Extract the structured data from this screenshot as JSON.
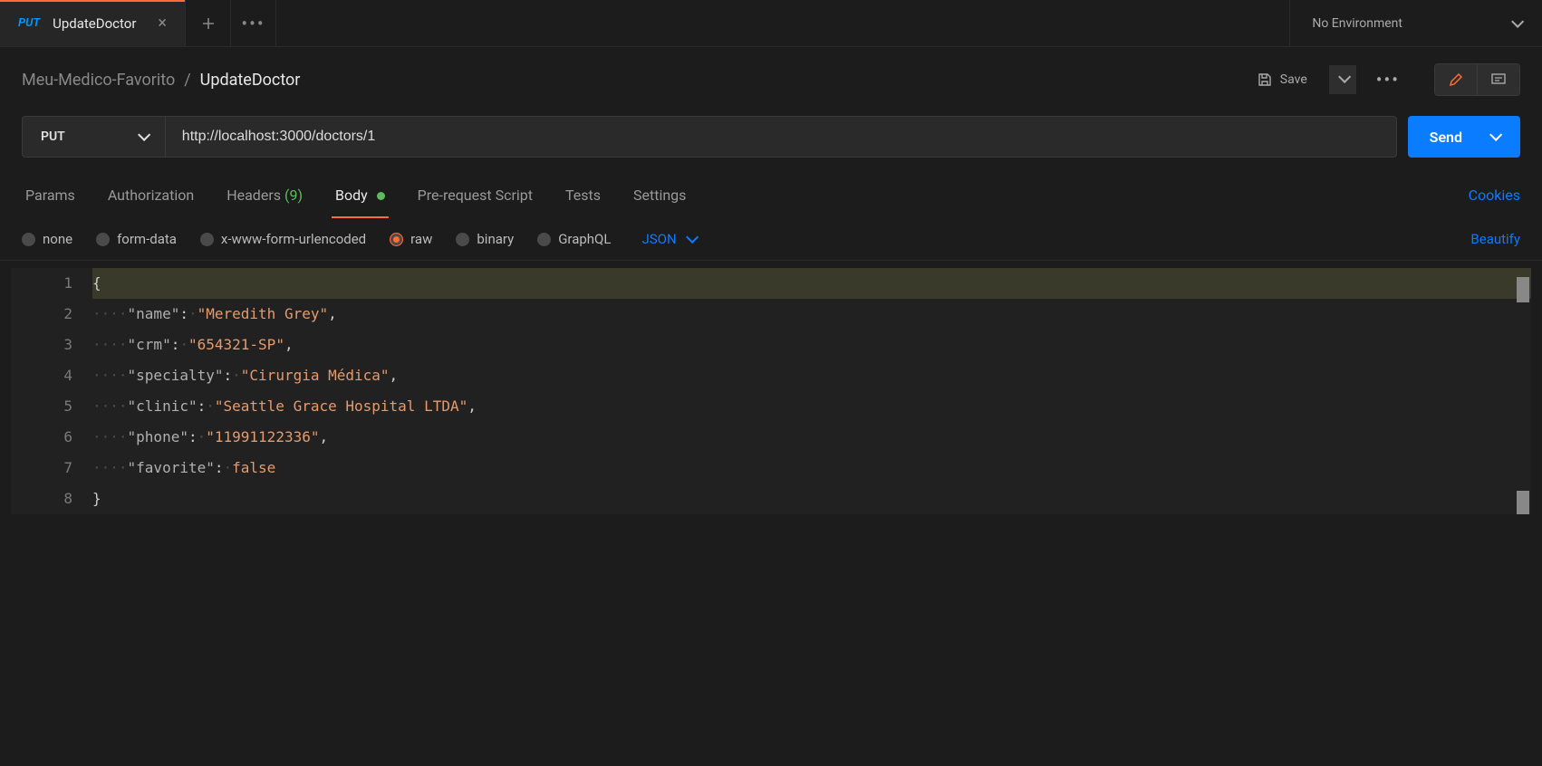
{
  "tab": {
    "method": "PUT",
    "name": "UpdateDoctor"
  },
  "environment": "No Environment",
  "breadcrumb": {
    "collection": "Meu-Medico-Favorito",
    "request": "UpdateDoctor"
  },
  "save_label": "Save",
  "request": {
    "method": "PUT",
    "url": "http://localhost:3000/doctors/1"
  },
  "send_label": "Send",
  "req_tabs": {
    "params": "Params",
    "auth": "Authorization",
    "headers": "Headers",
    "headers_count": "(9)",
    "body": "Body",
    "prerequest": "Pre-request Script",
    "tests": "Tests",
    "settings": "Settings"
  },
  "cookies_label": "Cookies",
  "body_types": {
    "none": "none",
    "formdata": "form-data",
    "urlencoded": "x-www-form-urlencoded",
    "raw": "raw",
    "binary": "binary",
    "graphql": "GraphQL"
  },
  "body_format": "JSON",
  "beautify_label": "Beautify",
  "editor": {
    "line_numbers": [
      "1",
      "2",
      "3",
      "4",
      "5",
      "6",
      "7",
      "8"
    ]
  },
  "body_json": {
    "name": "Meredith Grey",
    "crm": "654321-SP",
    "specialty": "Cirurgia Médica",
    "clinic": "Seattle Grace Hospital LTDA",
    "phone": "11991122336",
    "favorite": false
  }
}
